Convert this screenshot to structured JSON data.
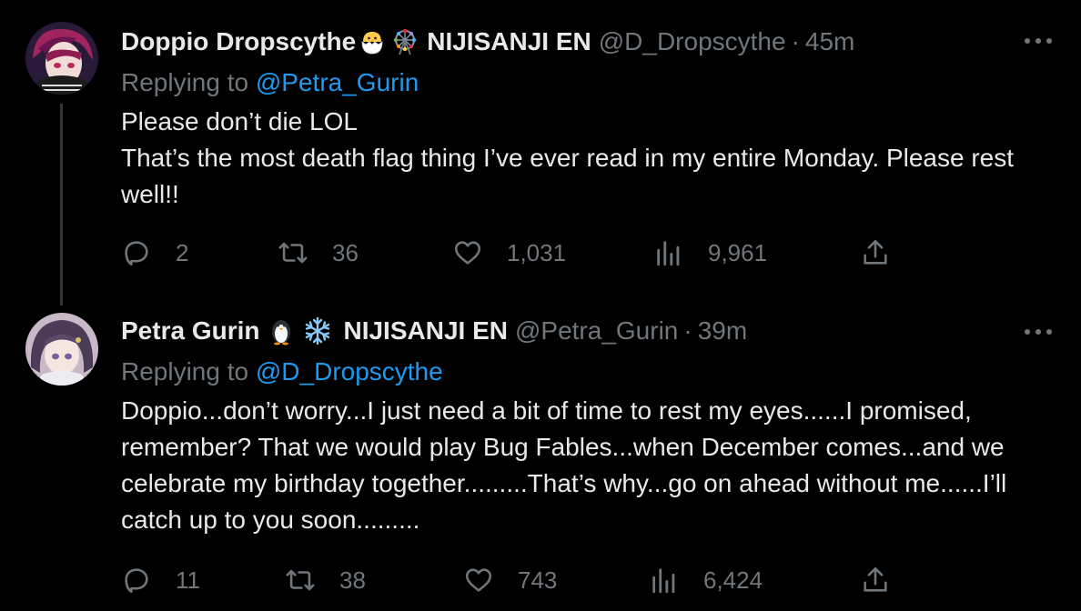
{
  "tweets": [
    {
      "display_name": "Doppio Dropscythe",
      "emojis": [
        "hatching-chick-icon",
        "ferris-wheel-icon"
      ],
      "affiliation": "NIJISANJI EN",
      "handle": "@D_Dropscythe",
      "separator": "·",
      "time": "45m",
      "replying_prefix": "Replying to ",
      "replying_to": "@Petra_Gurin",
      "body_lines": [
        "Please don’t die LOL",
        "That’s the most death flag thing I’ve ever read in my entire Monday. Please rest well!!"
      ],
      "stats": {
        "replies": "2",
        "retweets": "36",
        "likes": "1,031",
        "views": "9,961"
      }
    },
    {
      "display_name": "Petra Gurin",
      "emojis": [
        "penguin-icon",
        "snowflake-icon"
      ],
      "affiliation": "NIJISANJI EN",
      "handle": "@Petra_Gurin",
      "separator": "·",
      "time": "39m",
      "replying_prefix": "Replying to ",
      "replying_to": "@D_Dropscythe",
      "body_lines": [
        "Doppio...don’t worry...I just need a bit of time to rest my eyes......I promised, remember? That we would play Bug Fables...when December comes...and we celebrate my birthday together.........That’s why...go on ahead without me......I’ll catch up to you soon........."
      ],
      "stats": {
        "replies": "11",
        "retweets": "38",
        "likes": "743",
        "views": "6,424"
      }
    }
  ],
  "colors": {
    "background": "#000000",
    "text": "#e7e9ea",
    "secondary": "#71767b",
    "link": "#1d9bf0",
    "thread_line": "#333639"
  }
}
